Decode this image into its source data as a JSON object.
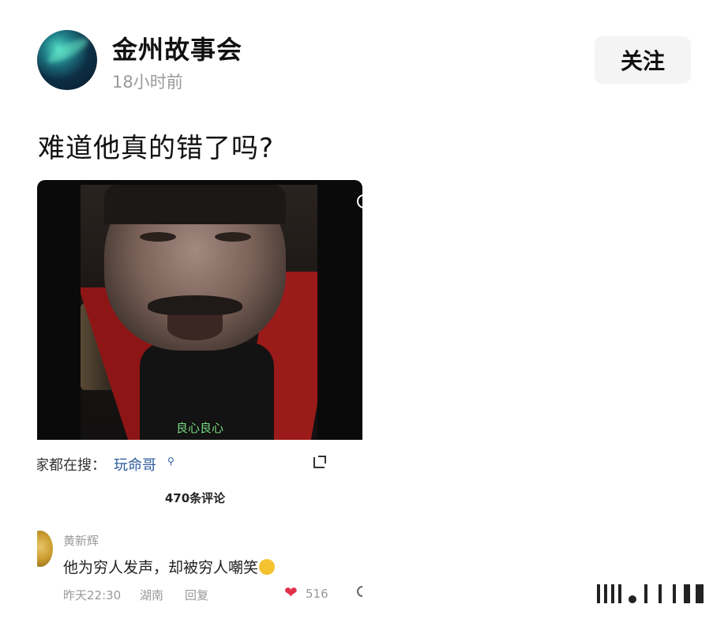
{
  "header": {
    "account_name": "金州故事会",
    "post_time": "18小时前",
    "follow_label": "关注"
  },
  "post": {
    "title": "难道他真的错了吗?"
  },
  "embed": {
    "video_subtitle": "良心良心",
    "search_prefix": "家都在搜：",
    "search_term": "玩命哥",
    "comment_count": "470条评论",
    "comment": {
      "user": "黄新辉",
      "text": "他为穷人发声，却被穷人嘲笑",
      "emoji_name": "laughing-crying-icon",
      "time": "昨天22:30",
      "location": "湖南",
      "reply_label": "回复",
      "likes": "516"
    }
  },
  "colors": {
    "follow_button_bg": "#f4f4f4",
    "search_term": "#2d5a9c",
    "heart": "#e0304a"
  }
}
